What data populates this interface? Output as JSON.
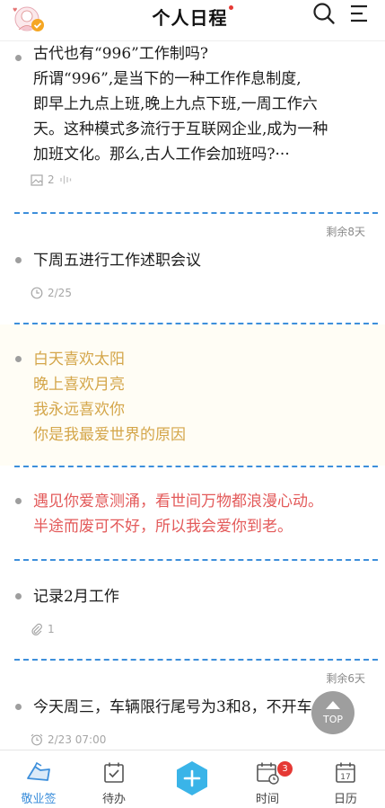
{
  "header": {
    "title": "个人日程"
  },
  "notes": [
    {
      "text": "古代也有“996”工作制吗?\n所谓“996”,是当下的一种工作作息制度,\n即早上九点上班,晚上九点下班,一周工作六\n天。这种模式多流行于互联网企业,成为一种\n加班文化。那么,古人工作会加班吗?···",
      "image_count": "2",
      "color": "#1c1c1c"
    },
    {
      "remaining": "剩余8天",
      "text": "下周五进行工作述职会议",
      "date": "2/25",
      "color": "#1c1c1c"
    },
    {
      "text": "白天喜欢太阳\n晚上喜欢月亮\n我永远喜欢你\n你是我最爱世界的原因",
      "color": "#d4a64a"
    },
    {
      "text": "遇见你爱意测涌，看世间万物都浪漫心动。\n半途而废可不好，所以我会爱你到老。",
      "color": "#e35a5a"
    },
    {
      "text": "记录2月工作",
      "attachment_count": "1",
      "color": "#1c1c1c"
    },
    {
      "remaining": "剩余6天",
      "text": "今天周三，车辆限行尾号为3和8，不开车",
      "datetime": "2/23  07:00",
      "color": "#1c1c1c"
    }
  ],
  "top_button": "TOP",
  "tabbar": {
    "tabs": [
      {
        "label": "敬业签",
        "active": true
      },
      {
        "label": "待办"
      },
      {
        "label": "时间",
        "badge": "3"
      },
      {
        "label": "日历",
        "calendar_day": "17"
      }
    ]
  },
  "colors": {
    "accent": "#3d8fdb",
    "badge": "#e53935"
  }
}
